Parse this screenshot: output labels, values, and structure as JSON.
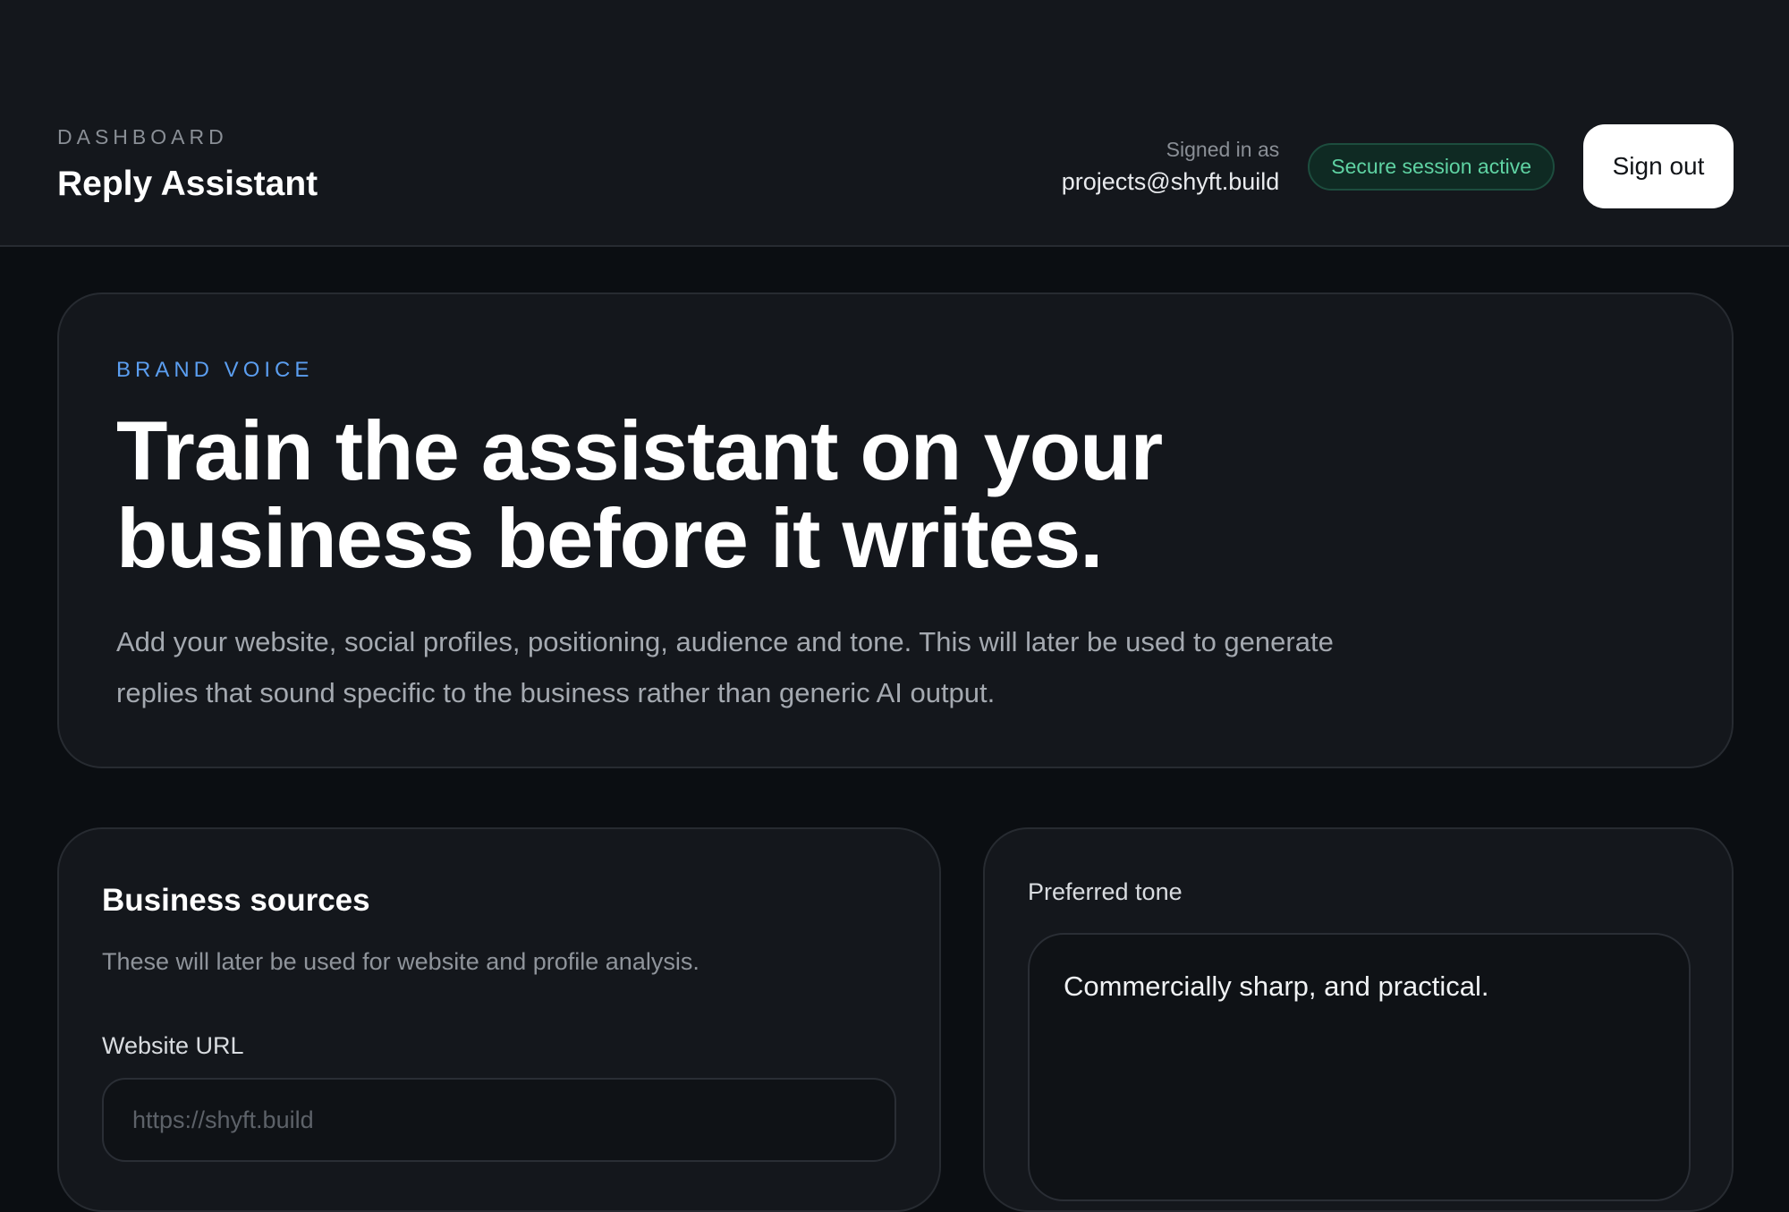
{
  "header": {
    "eyebrow": "DASHBOARD",
    "title": "Reply Assistant",
    "signed_in_label": "Signed in as",
    "signed_in_email": "projects@shyft.build",
    "session_badge": "Secure session active",
    "sign_out_label": "Sign out"
  },
  "hero": {
    "eyebrow": "BRAND VOICE",
    "title": "Train the assistant on your business before it writes.",
    "description": "Add your website, social profiles, positioning, audience and tone. This will later be used to generate replies that sound specific to the business rather than generic AI output."
  },
  "sources": {
    "title": "Business sources",
    "description": "These will later be used for website and profile analysis.",
    "website_label": "Website URL",
    "website_value": "",
    "website_placeholder": "https://shyft.build"
  },
  "tone": {
    "label": "Preferred tone",
    "value": "Commercially sharp, and practical."
  },
  "colors": {
    "background": "#0b0e12",
    "surface": "#14171c",
    "accent_blue": "#5b9ef0",
    "success_green": "#5fd3a3"
  }
}
